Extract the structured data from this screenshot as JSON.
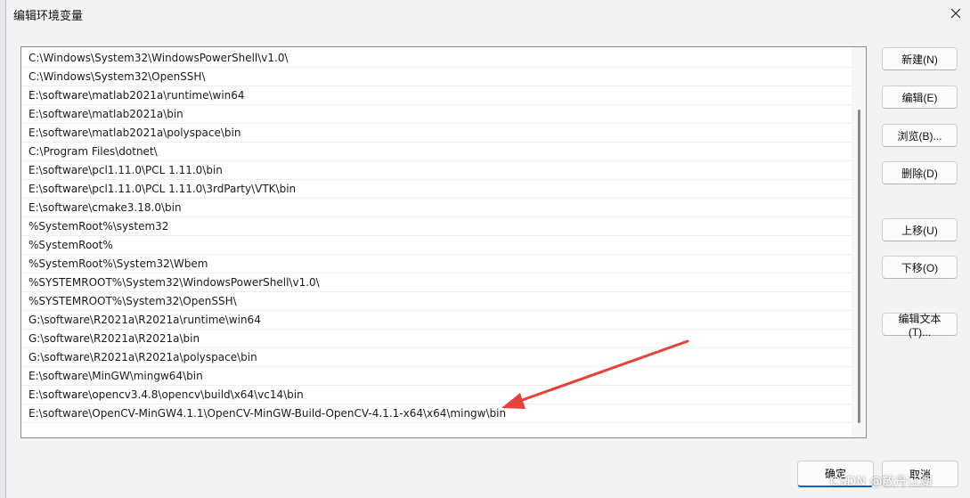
{
  "dialog": {
    "title": "编辑环境变量"
  },
  "paths": [
    "C:\\Windows\\System32\\WindowsPowerShell\\v1.0\\",
    "C:\\Windows\\System32\\OpenSSH\\",
    "E:\\software\\matlab2021a\\runtime\\win64",
    "E:\\software\\matlab2021a\\bin",
    "E:\\software\\matlab2021a\\polyspace\\bin",
    "C:\\Program Files\\dotnet\\",
    "E:\\software\\pcl1.11.0\\PCL 1.11.0\\bin",
    "E:\\software\\pcl1.11.0\\PCL 1.11.0\\3rdParty\\VTK\\bin",
    "E:\\software\\cmake3.18.0\\bin",
    "%SystemRoot%\\system32",
    "%SystemRoot%",
    "%SystemRoot%\\System32\\Wbem",
    "%SYSTEMROOT%\\System32\\WindowsPowerShell\\v1.0\\",
    "%SYSTEMROOT%\\System32\\OpenSSH\\",
    "G:\\software\\R2021a\\R2021a\\runtime\\win64",
    "G:\\software\\R2021a\\R2021a\\bin",
    "G:\\software\\R2021a\\R2021a\\polyspace\\bin",
    "E:\\software\\MinGW\\mingw64\\bin",
    "E:\\software\\opencv3.4.8\\opencv\\build\\x64\\vc14\\bin",
    "E:\\software\\OpenCV-MinGW4.1.1\\OpenCV-MinGW-Build-OpenCV-4.1.1-x64\\x64\\mingw\\bin"
  ],
  "buttons": {
    "new": "新建(N)",
    "edit": "编辑(E)",
    "browse": "浏览(B)...",
    "delete": "删除(D)",
    "move_up": "上移(U)",
    "move_down": "下移(O)",
    "edit_text": "编辑文本(T)...",
    "ok": "确定",
    "cancel": "取消"
  },
  "watermark": "CSDN @放舟江湖",
  "colors": {
    "annotation_arrow": "#e8403a",
    "ok_accent": "#0a64c2"
  }
}
